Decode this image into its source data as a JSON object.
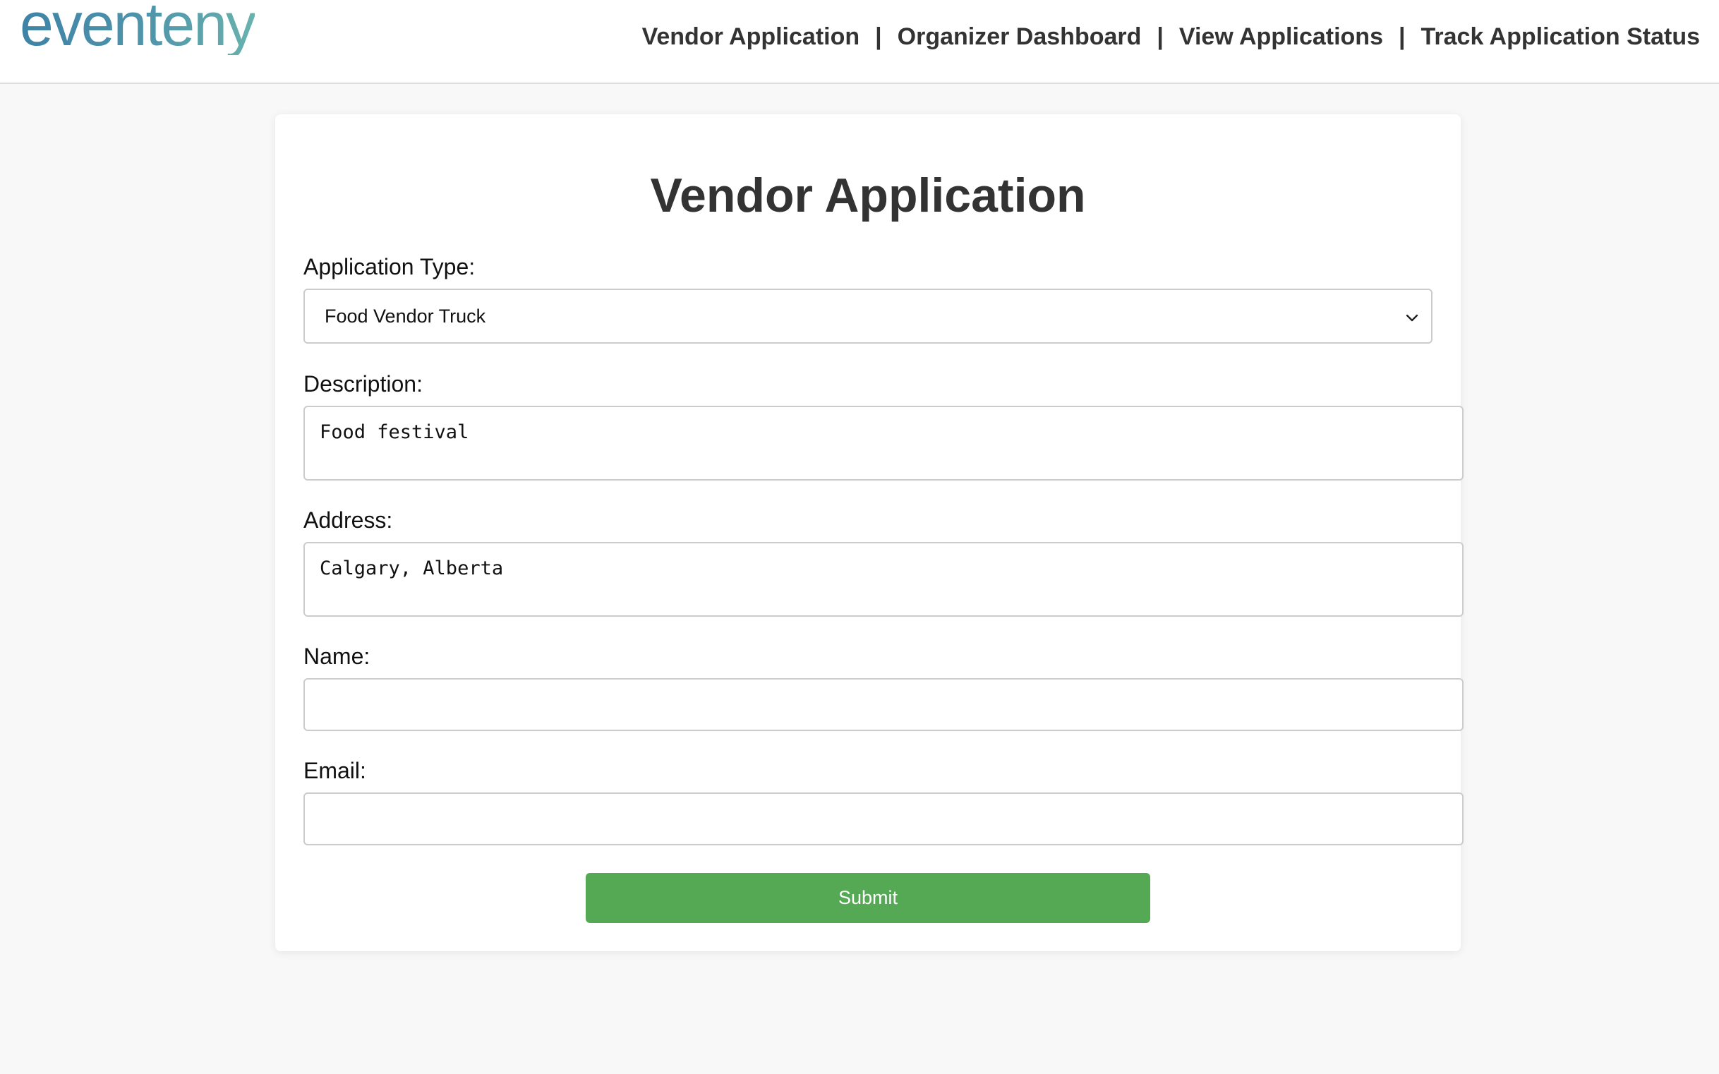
{
  "header": {
    "logo_text": "eventeny",
    "nav": {
      "vendor_application": "Vendor Application",
      "organizer_dashboard": "Organizer Dashboard",
      "view_applications": "View Applications",
      "track_status": "Track Application Status",
      "separator": "|"
    }
  },
  "form": {
    "title": "Vendor Application",
    "application_type": {
      "label": "Application Type:",
      "selected": "Food Vendor Truck"
    },
    "description": {
      "label": "Description:",
      "value": "Food festival"
    },
    "address": {
      "label": "Address:",
      "value": "Calgary, Alberta"
    },
    "name": {
      "label": "Name:",
      "value": ""
    },
    "email": {
      "label": "Email:",
      "value": ""
    },
    "submit_label": "Submit"
  },
  "colors": {
    "logo": "#4a8fa8",
    "submit": "#55a854",
    "background": "#f8f8f8",
    "text": "#333333"
  },
  "icons": {
    "select_caret": "chevron-down-icon"
  }
}
